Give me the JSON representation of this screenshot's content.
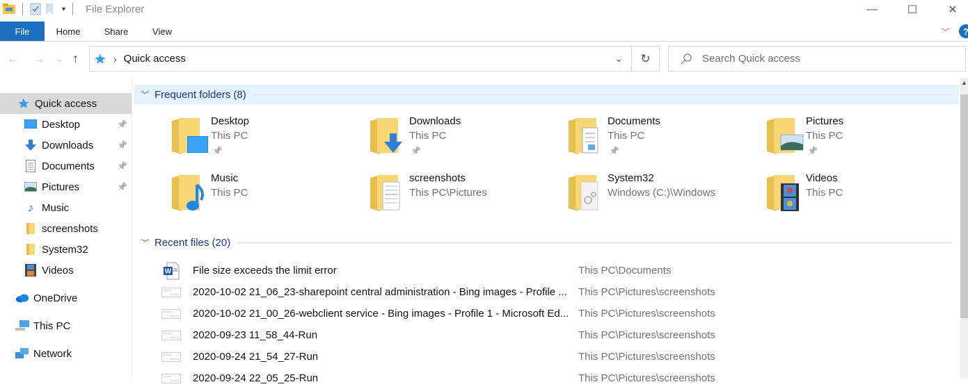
{
  "window": {
    "title": "File Explorer",
    "controls": {
      "minimize": "—",
      "maximize": "☐",
      "close": "✕"
    }
  },
  "ribbon": {
    "tabs": [
      {
        "label": "File",
        "active": true
      },
      {
        "label": "Home"
      },
      {
        "label": "Share"
      },
      {
        "label": "View"
      }
    ],
    "help": "?"
  },
  "navbar": {
    "back": "←",
    "forward": "→",
    "recent": "⌄",
    "up": "↑",
    "address": "Quick access",
    "separator": "›",
    "dropdown": "⌄",
    "refresh": "↻",
    "search_placeholder": "Search Quick access"
  },
  "sidebar": {
    "items": [
      {
        "label": "Quick access",
        "icon": "star-icon",
        "selected": true
      },
      {
        "label": "Desktop",
        "icon": "desktop-icon",
        "pinned": true
      },
      {
        "label": "Downloads",
        "icon": "download-icon",
        "pinned": true
      },
      {
        "label": "Documents",
        "icon": "document-icon",
        "pinned": true
      },
      {
        "label": "Pictures",
        "icon": "picture-icon",
        "pinned": true
      },
      {
        "label": "Music",
        "icon": "music-icon"
      },
      {
        "label": "screenshots",
        "icon": "folder-icon"
      },
      {
        "label": "System32",
        "icon": "folder-icon"
      },
      {
        "label": "Videos",
        "icon": "video-icon"
      },
      {
        "label": "OneDrive",
        "icon": "cloud-icon"
      },
      {
        "label": "This PC",
        "icon": "computer-icon"
      },
      {
        "label": "Network",
        "icon": "network-icon"
      }
    ]
  },
  "frequent": {
    "header": "Frequent folders (8)",
    "folders": [
      {
        "name": "Desktop",
        "location": "This PC",
        "pinned": true
      },
      {
        "name": "Downloads",
        "location": "This PC",
        "pinned": true
      },
      {
        "name": "Documents",
        "location": "This PC",
        "pinned": true
      },
      {
        "name": "Pictures",
        "location": "This PC",
        "pinned": true
      },
      {
        "name": "Music",
        "location": "This PC"
      },
      {
        "name": "screenshots",
        "location": "This PC\\Pictures"
      },
      {
        "name": "System32",
        "location": "Windows (C:)\\Windows"
      },
      {
        "name": "Videos",
        "location": "This PC"
      }
    ]
  },
  "recent": {
    "header": "Recent files (20)",
    "files": [
      {
        "name": "File size exceeds the limit error",
        "location": "This PC\\Documents",
        "type": "word"
      },
      {
        "name": "2020-10-02 21_06_23-sharepoint central administration - Bing images - Profile ...",
        "location": "This PC\\Pictures\\screenshots",
        "type": "image"
      },
      {
        "name": "2020-10-02 21_00_26-webclient service - Bing images - Profile 1 - Microsoft Ed...",
        "location": "This PC\\Pictures\\screenshots",
        "type": "image"
      },
      {
        "name": "2020-09-23 11_58_44-Run",
        "location": "This PC\\Pictures\\screenshots",
        "type": "image"
      },
      {
        "name": "2020-09-24 21_54_27-Run",
        "location": "This PC\\Pictures\\screenshots",
        "type": "image"
      },
      {
        "name": "2020-09-24 22_05_25-Run",
        "location": "This PC\\Pictures\\screenshots",
        "type": "image"
      }
    ]
  },
  "pin_glyph": "📌"
}
